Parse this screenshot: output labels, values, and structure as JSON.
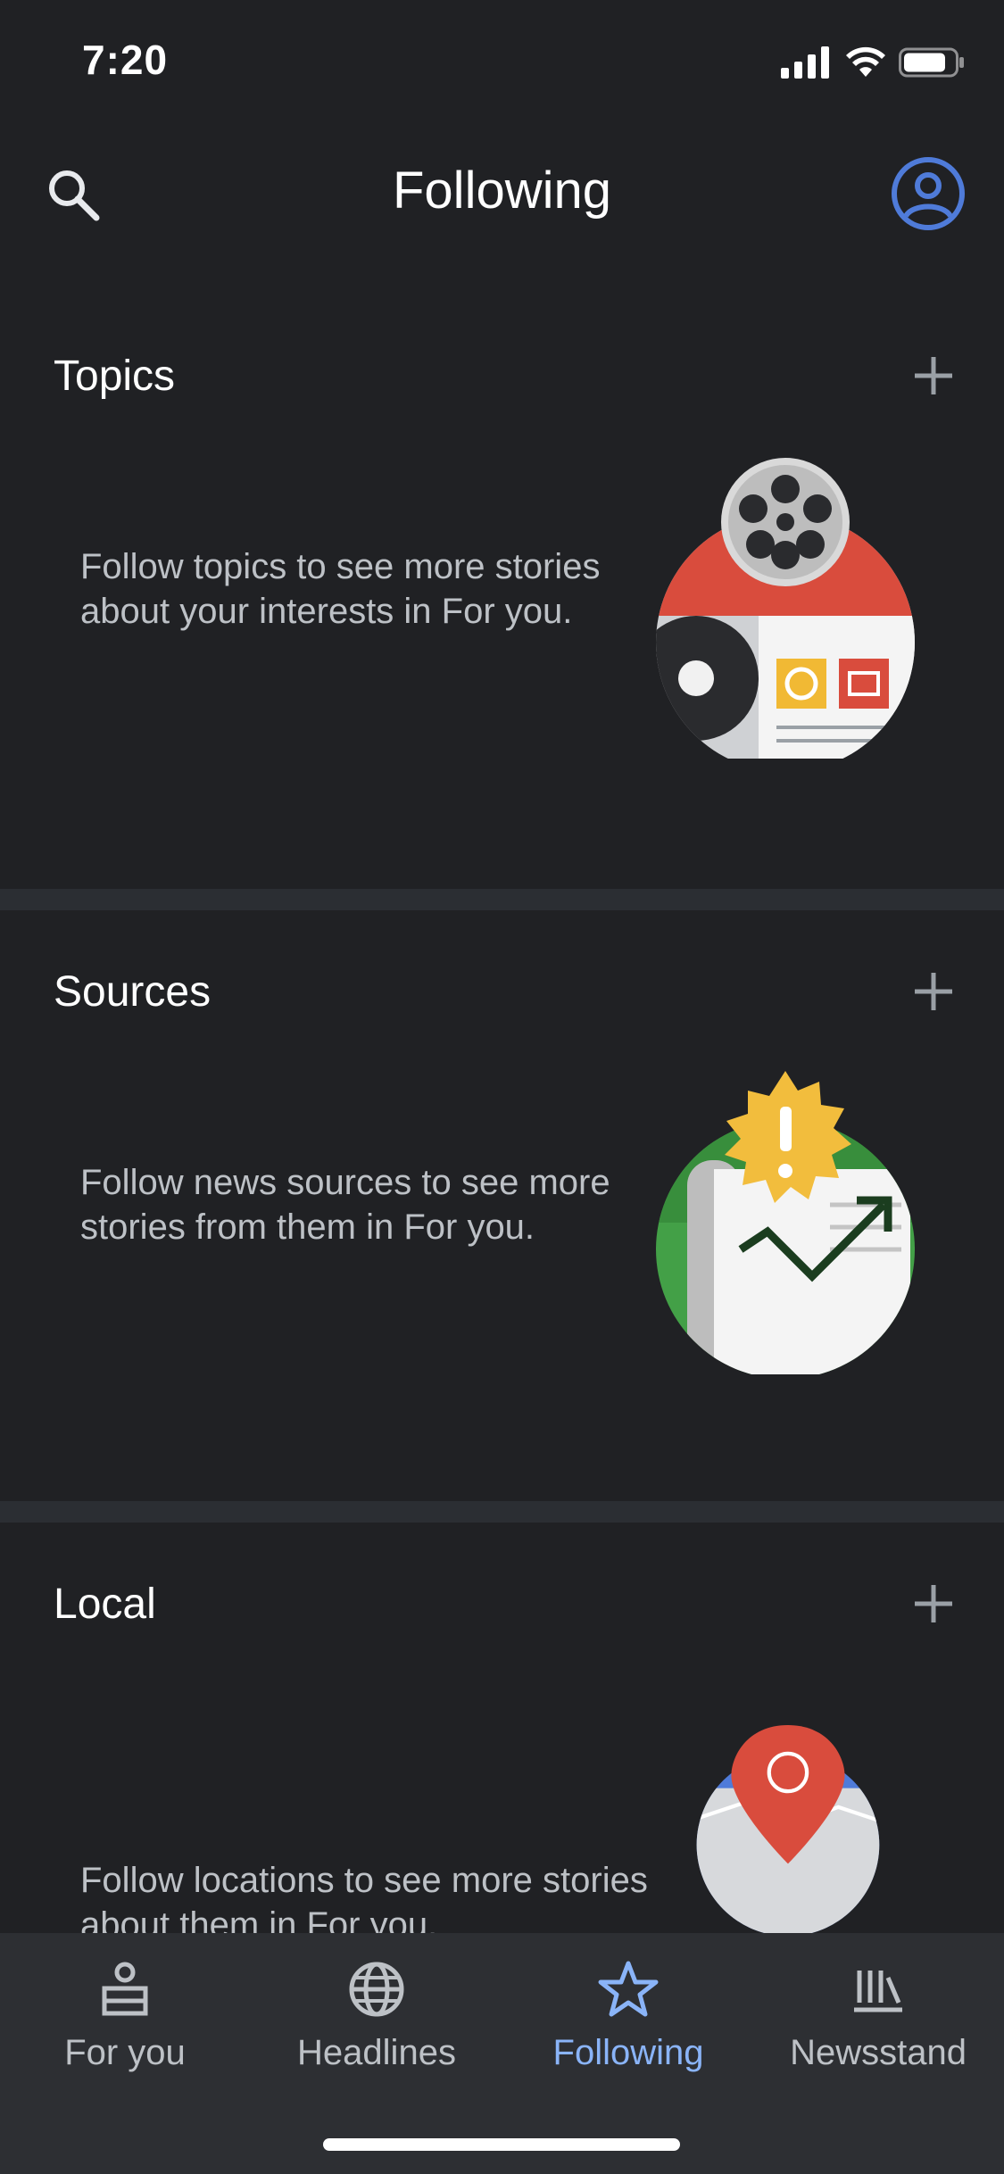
{
  "status_bar": {
    "time": "7:20"
  },
  "header": {
    "title": "Following"
  },
  "sections": [
    {
      "title": "Topics",
      "text": "Follow topics to see more stories about your interests in For you."
    },
    {
      "title": "Sources",
      "text": "Follow news sources to see more stories from them in For you."
    },
    {
      "title": "Local",
      "text": "Follow locations to see more stories about them in For you."
    }
  ],
  "bottom_nav": {
    "items": [
      {
        "label": "For you",
        "icon": "for-you-icon"
      },
      {
        "label": "Headlines",
        "icon": "globe-icon"
      },
      {
        "label": "Following",
        "icon": "star-icon",
        "active": true
      },
      {
        "label": "Newsstand",
        "icon": "newsstand-icon"
      }
    ]
  },
  "colors": {
    "background": "#202124",
    "accent": "#8ab4f8",
    "account_blue": "#4f7bd9",
    "divider": "#2b2e33"
  }
}
